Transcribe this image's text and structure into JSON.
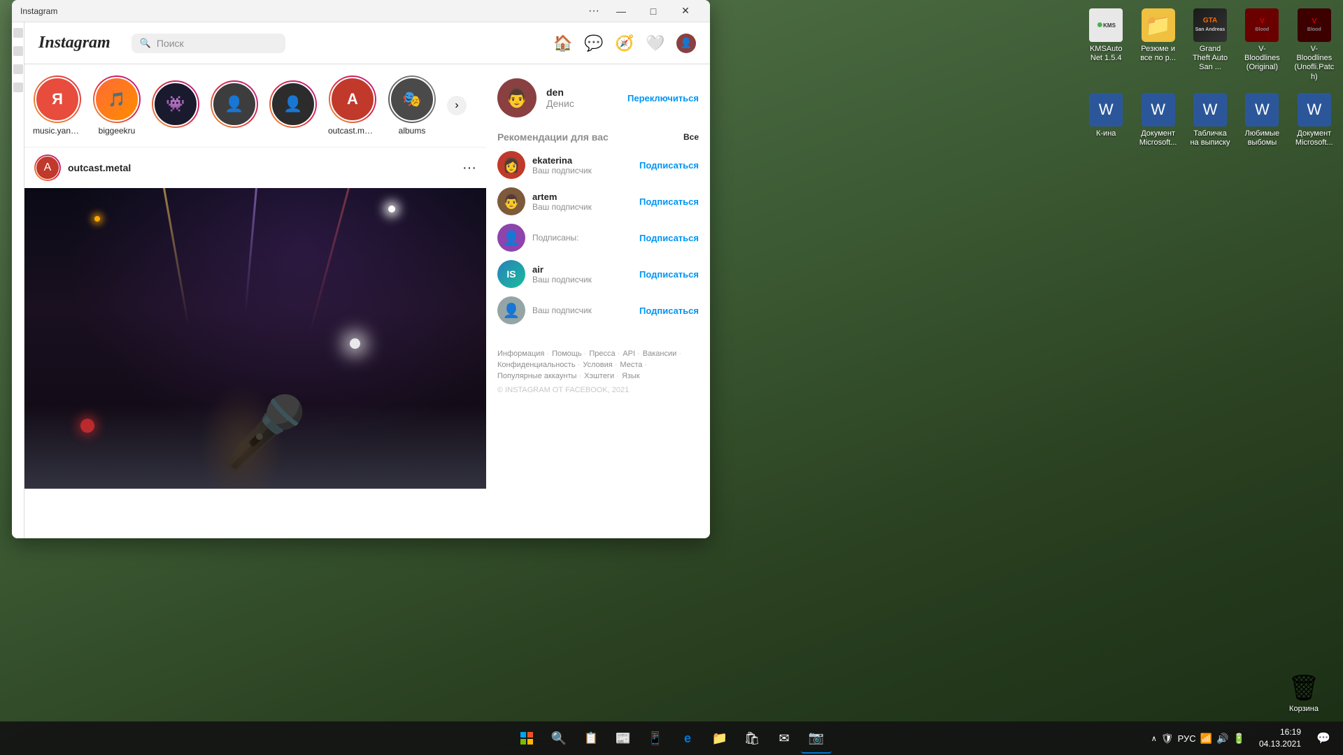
{
  "window": {
    "title": "Instagram",
    "controls": {
      "dots": "···",
      "minimize": "—",
      "maximize": "□",
      "close": "✕"
    }
  },
  "instagram": {
    "logo": "Instagram",
    "search": {
      "placeholder": "Поиск"
    },
    "stories": [
      {
        "label": "music.yandex",
        "color": "#e74c3c",
        "type": "yandex"
      },
      {
        "label": "biggeekru",
        "color": "#ff6b35",
        "type": "geek"
      },
      {
        "label": "",
        "color": "#5c6bc0",
        "type": "pixel"
      },
      {
        "label": "",
        "color": "#4a4a4a",
        "type": "dark"
      },
      {
        "label": "",
        "color": "#2c2c2c",
        "type": "dark2"
      },
      {
        "label": "outcast.metal",
        "color": "#c0392b",
        "type": "metal"
      },
      {
        "label": "albums",
        "color": "#555",
        "type": "albums"
      }
    ],
    "post": {
      "username": "outcast.metal",
      "more": "···"
    },
    "profile": {
      "username": "den",
      "name": "Денис",
      "switch_label": "Переключиться"
    },
    "recommendations": {
      "title": "Рекомендации для вас",
      "all_label": "Все",
      "items": [
        {
          "username": "ekaterina",
          "subtitle": "Ваш подписчик",
          "follow": "Подписаться",
          "color": "#c0392b"
        },
        {
          "username": "artem",
          "subtitle": "Ваш подписчик",
          "follow": "Подписаться",
          "color": "#7d5a3c"
        },
        {
          "username": "",
          "subtitle": "Подписаны:",
          "follow": "Подписаться",
          "color": "#8e44ad"
        },
        {
          "username": "air",
          "subtitle": "Ваш подписчик",
          "follow": "Подписаться",
          "color": "#2980b9"
        },
        {
          "username": "",
          "subtitle": "Ваш подписчик",
          "follow": "Подписаться",
          "color": "#95a5a6"
        }
      ]
    },
    "footer": {
      "links": [
        "Информация",
        "Помощь",
        "Пресса",
        "API",
        "Вакансии",
        "Конфиденциальность",
        "Условия",
        "Места",
        "Популярные аккаунты",
        "Хэштеги",
        "Язык"
      ],
      "copyright": "© INSTAGRAM ОТ FACEBOOK, 2021"
    }
  },
  "desktop": {
    "icons": [
      {
        "label": "KMSAuto Net 1.5.4",
        "type": "kmsa",
        "row": 1
      },
      {
        "label": "Резюме и все по р...",
        "type": "folder",
        "row": 1
      },
      {
        "label": "Grand Theft Auto San ...",
        "type": "gta",
        "row": 1
      },
      {
        "label": "V-Bloodlines (Original)",
        "type": "vb",
        "row": 1
      },
      {
        "label": "V-Bloodlines (Unofli.Patch)",
        "type": "vb2",
        "row": 1
      },
      {
        "label": "К-ина",
        "type": "word",
        "row": 2
      },
      {
        "label": "Документ Microsoft...",
        "type": "word",
        "row": 2
      },
      {
        "label": "Табличка на выписку",
        "type": "word",
        "row": 2
      },
      {
        "label": "Любимые выбомы",
        "type": "word",
        "row": 2
      },
      {
        "label": "Документ Microsoft...",
        "type": "word",
        "row": 2
      }
    ],
    "recycle_bin": {
      "label": "Корзина"
    }
  },
  "taskbar": {
    "time": "16:19",
    "date": "04.13.2021",
    "language": "РУС",
    "apps": [
      "⊞",
      "🔍",
      "📁",
      "📰",
      "📱",
      "🌐",
      "📂",
      "🛍",
      "✉",
      "📷"
    ]
  }
}
